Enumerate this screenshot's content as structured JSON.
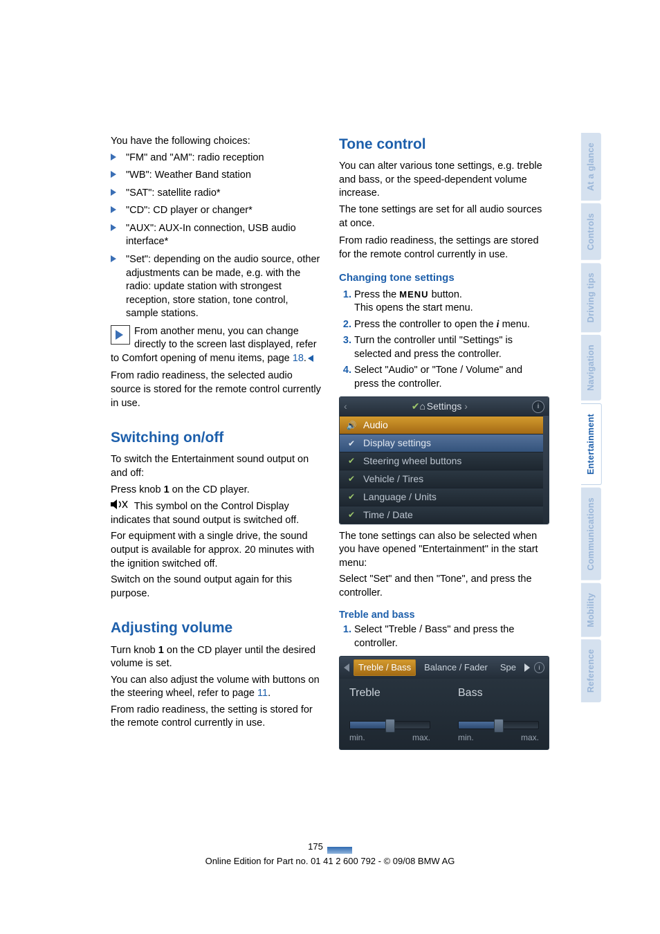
{
  "left": {
    "intro": "You have the following choices:",
    "bullets": [
      "\"FM\" and \"AM\": radio reception",
      "\"WB\": Weather Band station",
      "\"SAT\": satellite radio*",
      "\"CD\": CD player or changer*",
      "\"AUX\": AUX-In connection, USB audio interface*",
      "\"Set\": depending on the audio source, other adjustments can be made, e.g. with the radio: update station with strongest reception, store station, tone control, sample stations."
    ],
    "hint1_a": "From another menu, you can change directly to the screen last displayed, refer to Comfort opening of menu items, page ",
    "hint1_link": "18",
    "hint1_b": ".",
    "afterhint": "From radio readiness, the selected audio source is stored for the remote control currently in use.",
    "h_switch": "Switching on/off",
    "sw1": "To switch the Entertainment sound output on and off:",
    "sw2_a": "Press knob ",
    "sw2_b": "1",
    "sw2_c": " on the CD player.",
    "sw3": " This symbol on the Control Display indicates that sound output is switched off.",
    "sw4": "For equipment with a single drive, the sound output is available for approx. 20 minutes with the ignition switched off.",
    "sw5": "Switch on the sound output again for this purpose.",
    "h_vol": "Adjusting volume",
    "vol1_a": "Turn knob ",
    "vol1_b": "1",
    "vol1_c": " on the CD player until the desired volume is set.",
    "vol2_a": "You can also adjust the volume with buttons on the steering wheel, refer to page ",
    "vol2_link": "11",
    "vol2_b": ".",
    "vol3": "From radio readiness, the setting is stored for the remote control currently in use."
  },
  "right": {
    "h_tone": "Tone control",
    "tone_intro1": "You can alter various tone settings, e.g. treble and bass, or the speed-dependent volume increase.",
    "tone_intro2": "The tone settings are set for all audio sources at once.",
    "tone_intro3": "From radio readiness, the settings are stored for the remote control currently in use.",
    "h_change": "Changing tone settings",
    "steps_change": {
      "s1a": "Press the ",
      "s1menu": "MENU",
      "s1b": " button.",
      "s1c": "This opens the start menu.",
      "s2a": "Press the controller to open the ",
      "s2b": " menu.",
      "s3": "Turn the controller until \"Settings\" is selected and press the controller.",
      "s4": "Select \"Audio\" or \"Tone / Volume\" and press the controller."
    },
    "scr1": {
      "header": "Settings",
      "rows": [
        "Audio",
        "Display settings",
        "Steering wheel buttons",
        "Vehicle / Tires",
        "Language / Units",
        "Time / Date"
      ]
    },
    "after_scr1a": "The tone settings can also be selected when you have opened \"Entertainment\" in the start menu:",
    "after_scr1b": "Select \"Set\" and then \"Tone\", and press the controller.",
    "h_treble": "Treble and bass",
    "treble_step": "Select \"Treble / Bass\" and press the controller.",
    "scr2": {
      "tab1": "Treble / Bass",
      "tab2": "Balance / Fader",
      "tab3": "Spe",
      "lbl1": "Treble",
      "lbl2": "Bass",
      "min": "min.",
      "max": "max."
    }
  },
  "sidetabs": [
    "At a glance",
    "Controls",
    "Driving tips",
    "Navigation",
    "Entertainment",
    "Communications",
    "Mobility",
    "Reference"
  ],
  "footer": {
    "page": "175",
    "credit": "Online Edition for Part no. 01 41 2 600 792 - © 09/08 BMW AG"
  }
}
